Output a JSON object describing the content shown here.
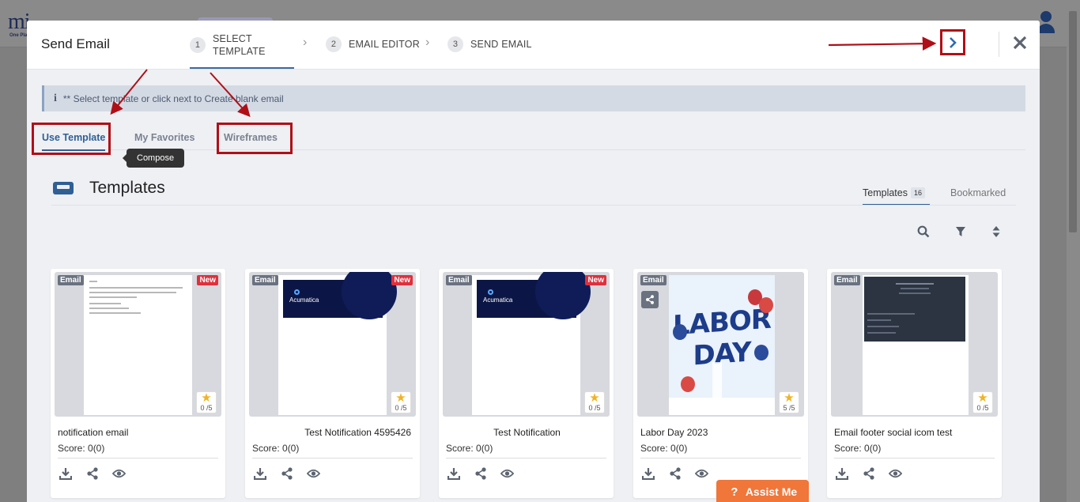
{
  "background": {
    "logo_text": "mi",
    "logo_sub": "One Pla"
  },
  "modal": {
    "title": "Send Email",
    "steps": [
      {
        "num": "1",
        "label": "SELECT TEMPLATE"
      },
      {
        "num": "2",
        "label": "EMAIL EDITOR"
      },
      {
        "num": "3",
        "label": "SEND EMAIL"
      }
    ],
    "next_icon": "chevron-right-icon",
    "close_icon": "close-icon"
  },
  "info": {
    "icon": "i",
    "text": "** Select template or click next to Create blank email"
  },
  "sub_tabs": {
    "use_template": "Use Template",
    "my_favorites": "My Favorites",
    "wireframes": "Wireframes",
    "active": "Use Template"
  },
  "tooltip": "Compose",
  "templates": {
    "title": "Templates",
    "tab_templates": "Templates",
    "tab_count": "16",
    "tab_bookmarked": "Bookmarked"
  },
  "cards": [
    {
      "type": "Email",
      "badge": "New",
      "name": "notification email",
      "score": "Score: 0(0)",
      "rating": "0 /5"
    },
    {
      "type": "Email",
      "badge": "New",
      "name": "Test Notification 4595426",
      "score": "Score: 0(0)",
      "rating": "0 /5"
    },
    {
      "type": "Email",
      "badge": "New",
      "name": "Test Notification",
      "score": "Score: 0(0)",
      "rating": "0 /5"
    },
    {
      "type": "Email",
      "badge": "",
      "name": "Labor Day 2023",
      "score": "Score: 0(0)",
      "rating": "5 /5"
    },
    {
      "type": "Email",
      "badge": "",
      "name": "Email footer social icom test",
      "score": "Score: 0(0)",
      "rating": "0 /5"
    }
  ],
  "thumb_text": {
    "acumatica": "Acumatica",
    "labor": "LABOR DAY"
  },
  "assist": {
    "icon": "?",
    "label": "Assist Me"
  },
  "colors": {
    "accent": "#2f5f94",
    "highlight": "#b00f17",
    "new_badge": "#e0303c",
    "assist": "#f0763a"
  }
}
